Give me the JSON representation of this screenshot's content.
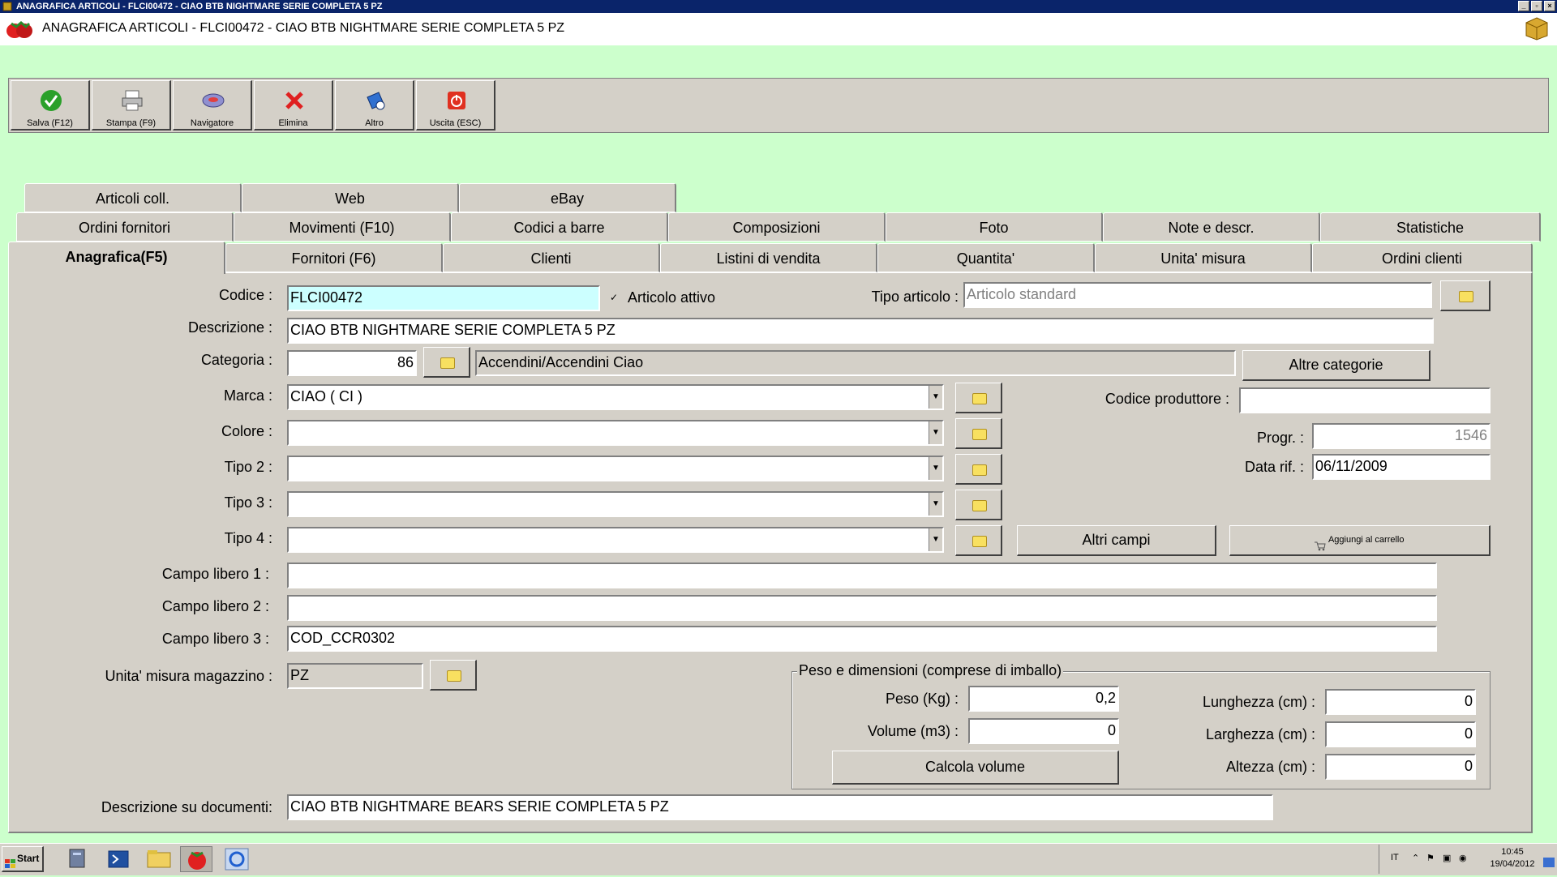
{
  "window": {
    "titlebar": "ANAGRAFICA ARTICOLI - FLCI00472 - CIAO BTB NIGHTMARE SERIE COMPLETA 5 PZ",
    "header_title": "ANAGRAFICA ARTICOLI - FLCI00472 - CIAO BTB NIGHTMARE SERIE COMPLETA 5 PZ"
  },
  "toolbar": [
    {
      "label": "Salva (F12)",
      "icon": "check-icon"
    },
    {
      "label": "Stampa (F9)",
      "icon": "printer-icon"
    },
    {
      "label": "Navigatore",
      "icon": "navigator-icon"
    },
    {
      "label": "Elimina",
      "icon": "delete-icon"
    },
    {
      "label": "Altro",
      "icon": "other-icon"
    },
    {
      "label": "Uscita (ESC)",
      "icon": "exit-icon"
    }
  ],
  "tabs": {
    "row1": [
      "Articoli coll.",
      "Web",
      "eBay"
    ],
    "row2": [
      "Ordini fornitori",
      "Movimenti (F10)",
      "Codici a barre",
      "Composizioni",
      "Foto",
      "Note e descr.",
      "Statistiche"
    ],
    "row3": [
      "Anagrafica(F5)",
      "Fornitori (F6)",
      "Clienti",
      "Listini di vendita",
      "Quantita'",
      "Unita' misura",
      "Ordini clienti"
    ],
    "active": "Anagrafica(F5)"
  },
  "form": {
    "codice_label": "Codice :",
    "codice": "FLCI00472",
    "articolo_attivo_label": "Articolo attivo",
    "articolo_attivo_check": "✓",
    "tipo_articolo_label": "Tipo articolo :",
    "tipo_articolo": "Articolo standard",
    "descrizione_label": "Descrizione :",
    "descrizione": "CIAO BTB NIGHTMARE SERIE COMPLETA 5 PZ",
    "categoria_label": "Categoria :",
    "categoria_code": "86",
    "categoria_name": "Accendini/Accendini Ciao",
    "altre_categorie": "Altre categorie",
    "marca_label": "Marca :",
    "marca": "CIAO ( CI )",
    "codice_produttore_label": "Codice produttore :",
    "codice_produttore": "",
    "colore_label": "Colore :",
    "colore": "",
    "progr_label": "Progr. :",
    "progr": "1546",
    "tipo2_label": "Tipo 2 :",
    "tipo2": "",
    "data_rif_label": "Data rif. :",
    "data_rif": "06/11/2009",
    "tipo3_label": "Tipo 3 :",
    "tipo3": "",
    "tipo4_label": "Tipo 4 :",
    "tipo4": "",
    "altri_campi": "Altri campi",
    "aggiungi_carrello": "Aggiungi al carrello",
    "campo_libero1_label": "Campo libero 1 :",
    "campo_libero1": "",
    "campo_libero2_label": "Campo libero 2 :",
    "campo_libero2": "",
    "campo_libero3_label": "Campo libero 3 :",
    "campo_libero3": "COD_CCR0302",
    "unita_label": "Unita' misura magazzino :",
    "unita": "PZ",
    "descrizione_doc_label": "Descrizione su documenti:",
    "descrizione_doc": "CIAO BTB NIGHTMARE BEARS SERIE COMPLETA 5 PZ"
  },
  "peso": {
    "legend": "Peso e dimensioni (comprese di imballo)",
    "peso_label": "Peso (Kg) :",
    "peso": "0,2",
    "volume_label": "Volume (m3) :",
    "volume": "0",
    "calcola_volume": "Calcola volume",
    "lunghezza_label": "Lunghezza (cm) :",
    "lunghezza": "0",
    "larghezza_label": "Larghezza (cm) :",
    "larghezza": "0",
    "altezza_label": "Altezza (cm) :",
    "altezza": "0"
  },
  "taskbar": {
    "start": "Start",
    "lang": "IT",
    "time": "10:45",
    "date": "19/04/2012"
  }
}
